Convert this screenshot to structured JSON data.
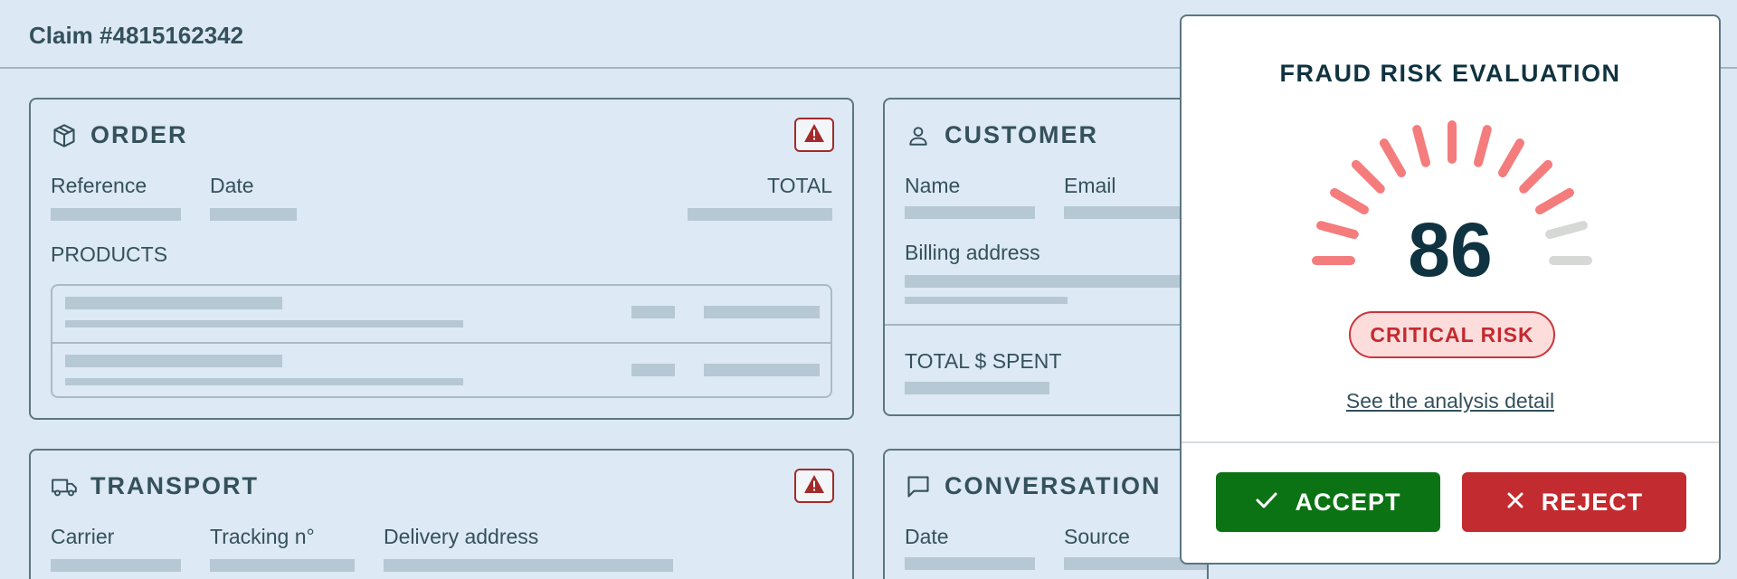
{
  "header": {
    "claim_title": "Claim #4815162342"
  },
  "order": {
    "title": "ORDER",
    "reference_label": "Reference",
    "date_label": "Date",
    "total_label": "TOTAL",
    "products_label": "PRODUCTS"
  },
  "customer": {
    "title": "CUSTOMER",
    "name_label": "Name",
    "email_label": "Email",
    "billing_label": "Billing address",
    "total_spent_label": "TOTAL $ SPENT"
  },
  "transport": {
    "title": "TRANSPORT",
    "carrier_label": "Carrier",
    "tracking_label": "Tracking n°",
    "delivery_label": "Delivery address"
  },
  "conversation": {
    "title": "CONVERSATION",
    "date_label": "Date",
    "source_label": "Source"
  },
  "fraud": {
    "title": "FRAUD RISK EVALUATION",
    "score": "86",
    "score_max": 100,
    "filled_segments": 11,
    "total_segments": 13,
    "risk_label": "CRITICAL RISK",
    "detail_link": "See the analysis detail",
    "accept_label": "ACCEPT",
    "reject_label": "REJECT"
  },
  "colors": {
    "background": "#dce9f4",
    "text": "#34515c",
    "gauge_filled": "#f47c7c",
    "gauge_empty": "#d6d8d6",
    "accept": "#0c7314",
    "reject": "#c22b2f",
    "warning": "#a12b2b"
  },
  "icons": {
    "order": "box-icon",
    "customer": "user-icon",
    "transport": "truck-icon",
    "conversation": "chat-icon",
    "warning": "warning-icon",
    "accept": "check-icon",
    "reject": "close-icon"
  }
}
